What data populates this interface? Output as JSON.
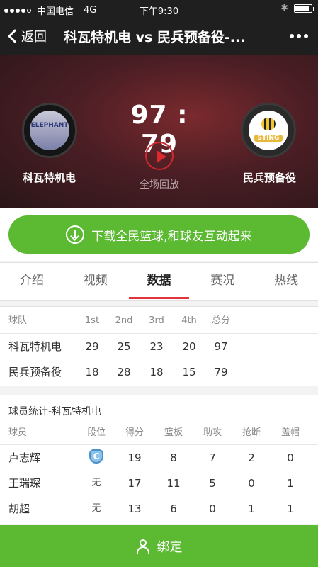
{
  "status_bar": {
    "carrier": "中国电信",
    "network": "4G",
    "time": "下午9:30",
    "battery_level": 0.85
  },
  "nav": {
    "back_label": "返回",
    "title": "科瓦特机电 vs 民兵预备役-..."
  },
  "hero": {
    "home_team": "科瓦特机电",
    "away_team": "民兵预备役",
    "score": "97 : 79",
    "replay_label": "全场回放",
    "home_logo_text": "ELEPHANT",
    "away_logo_text": "STING"
  },
  "banner": {
    "label": "下载全民篮球,和球友互动起来"
  },
  "tabs": [
    {
      "label": "介绍",
      "active": false
    },
    {
      "label": "视频",
      "active": false
    },
    {
      "label": "数据",
      "active": true
    },
    {
      "label": "赛况",
      "active": false
    },
    {
      "label": "热线",
      "active": false
    }
  ],
  "score_table": {
    "headers": [
      "球队",
      "1st",
      "2nd",
      "3rd",
      "4th",
      "总分"
    ],
    "rows": [
      {
        "team": "科瓦特机电",
        "q1": "29",
        "q2": "25",
        "q3": "23",
        "q4": "20",
        "total": "97"
      },
      {
        "team": "民兵预备役",
        "q1": "18",
        "q2": "28",
        "q3": "18",
        "q4": "15",
        "total": "79"
      }
    ]
  },
  "player_stats": {
    "title": "球员统计-科瓦特机电",
    "headers": [
      "球员",
      "段位",
      "得分",
      "篮板",
      "助攻",
      "抢断",
      "盖帽"
    ],
    "rows": [
      {
        "name": "卢志辉",
        "rank": "",
        "rank_badge": "C",
        "pts": "19",
        "reb": "8",
        "ast": "7",
        "stl": "2",
        "blk": "0"
      },
      {
        "name": "王瑞琛",
        "rank": "无",
        "pts": "17",
        "reb": "11",
        "ast": "5",
        "stl": "0",
        "blk": "1"
      },
      {
        "name": "胡超",
        "rank": "无",
        "pts": "13",
        "reb": "6",
        "ast": "0",
        "stl": "1",
        "blk": "1"
      }
    ]
  },
  "bind": {
    "label": "绑定"
  },
  "colors": {
    "accent_green": "#5bb932",
    "tab_active_red": "#e0353a",
    "header_dark": "#1f1f1f"
  }
}
